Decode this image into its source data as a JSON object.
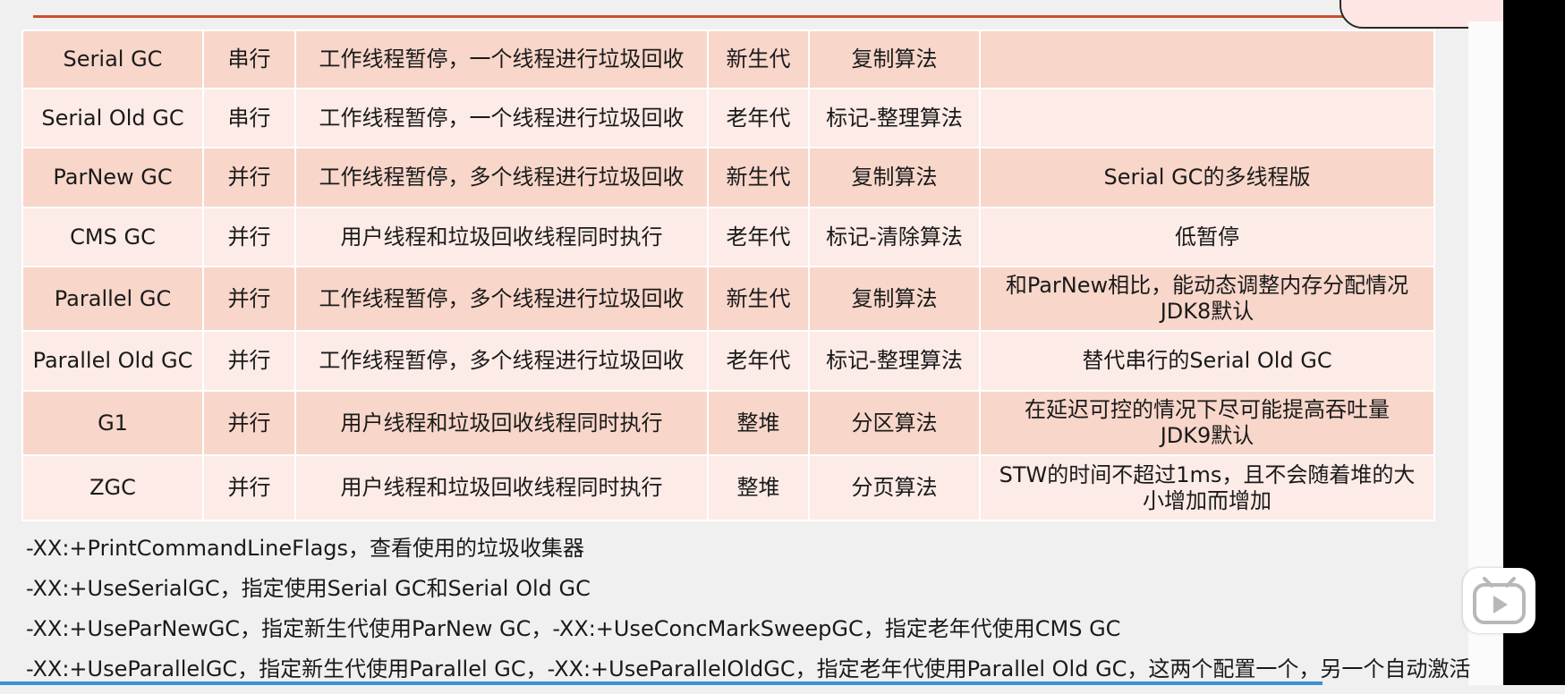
{
  "gc_table": {
    "rows": [
      {
        "name": "Serial GC",
        "mode": "串行",
        "description": "工作线程暂停，一个线程进行垃圾回收",
        "generation": "新生代",
        "algorithm": "复制算法",
        "note": ""
      },
      {
        "name": "Serial Old GC",
        "mode": "串行",
        "description": "工作线程暂停，一个线程进行垃圾回收",
        "generation": "老年代",
        "algorithm": "标记-整理算法",
        "note": ""
      },
      {
        "name": "ParNew GC",
        "mode": "并行",
        "description": "工作线程暂停，多个线程进行垃圾回收",
        "generation": "新生代",
        "algorithm": "复制算法",
        "note": "Serial GC的多线程版"
      },
      {
        "name": "CMS GC",
        "mode": "并行",
        "description": "用户线程和垃圾回收线程同时执行",
        "generation": "老年代",
        "algorithm": "标记-清除算法",
        "note": "低暂停"
      },
      {
        "name": "Parallel GC",
        "mode": "并行",
        "description": "工作线程暂停，多个线程进行垃圾回收",
        "generation": "新生代",
        "algorithm": "复制算法",
        "note": "和ParNew相比，能动态调整内存分配情况",
        "note_line2": "JDK8默认"
      },
      {
        "name": "Parallel Old GC",
        "mode": "并行",
        "description": "工作线程暂停，多个线程进行垃圾回收",
        "generation": "老年代",
        "algorithm": "标记-整理算法",
        "note": "替代串行的Serial Old GC"
      },
      {
        "name": "G1",
        "mode": "并行",
        "description": "用户线程和垃圾回收线程同时执行",
        "generation": "整堆",
        "algorithm": "分区算法",
        "note": "在延迟可控的情况下尽可能提高吞吐量",
        "note_line2": "JDK9默认"
      },
      {
        "name": "ZGC",
        "mode": "并行",
        "description": "用户线程和垃圾回收线程同时执行",
        "generation": "整堆",
        "algorithm": "分页算法",
        "note": "STW的时间不超过1ms，且不会随着堆的大",
        "note_line2": "小增加而增加"
      }
    ]
  },
  "notes": [
    "-XX:+PrintCommandLineFlags，查看使用的垃圾收集器",
    "-XX:+UseSerialGC，指定使用Serial GC和Serial Old GC",
    "-XX:+UseParNewGC，指定新生代使用ParNew GC，-XX:+UseConcMarkSweepGC，指定老年代使用CMS GC",
    "-XX:+UseParallelGC，指定新生代使用Parallel GC，-XX:+UseParallelOldGC，指定老年代使用Parallel Old GC，这两个配置一个，另一个自动激活"
  ],
  "icons": {
    "floating_button": "bilibili-tv-play-icon"
  },
  "colors": {
    "row_dark": "#f8d6ca",
    "row_light": "#fcebe6",
    "accent_rule": "#c9502e",
    "progress_line": "#3b8fd6"
  }
}
